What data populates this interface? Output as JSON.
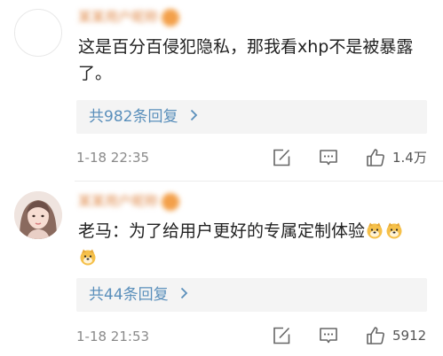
{
  "comments": [
    {
      "username": "某某用户昵称",
      "text": "这是百分百侵犯隐私，那我看xhp不是被暴露了。",
      "replies_label": "共982条回复",
      "time": "1-18 22:35",
      "likes": "1.4万",
      "avatar": "blank-avatar"
    },
    {
      "username": "某某用户昵称",
      "text": "老马：为了给用户更好的专属定制体验",
      "replies_label": "共44条回复",
      "time": "1-18 21:53",
      "likes": "5912",
      "avatar": "girl-portrait-avatar",
      "emoji_name": "doge-emoji",
      "emoji_count": 3
    }
  ],
  "icons": {
    "edit": "share-edit-icon",
    "comment": "comment-bubble-icon",
    "like": "thumbs-up-icon",
    "chevron": "chevron-right-icon"
  },
  "colors": {
    "link": "#5a8fbb",
    "username": "#e08a4a",
    "text": "#222222",
    "meta": "#8a8a8a",
    "reply_bg": "#f4f4f4"
  }
}
